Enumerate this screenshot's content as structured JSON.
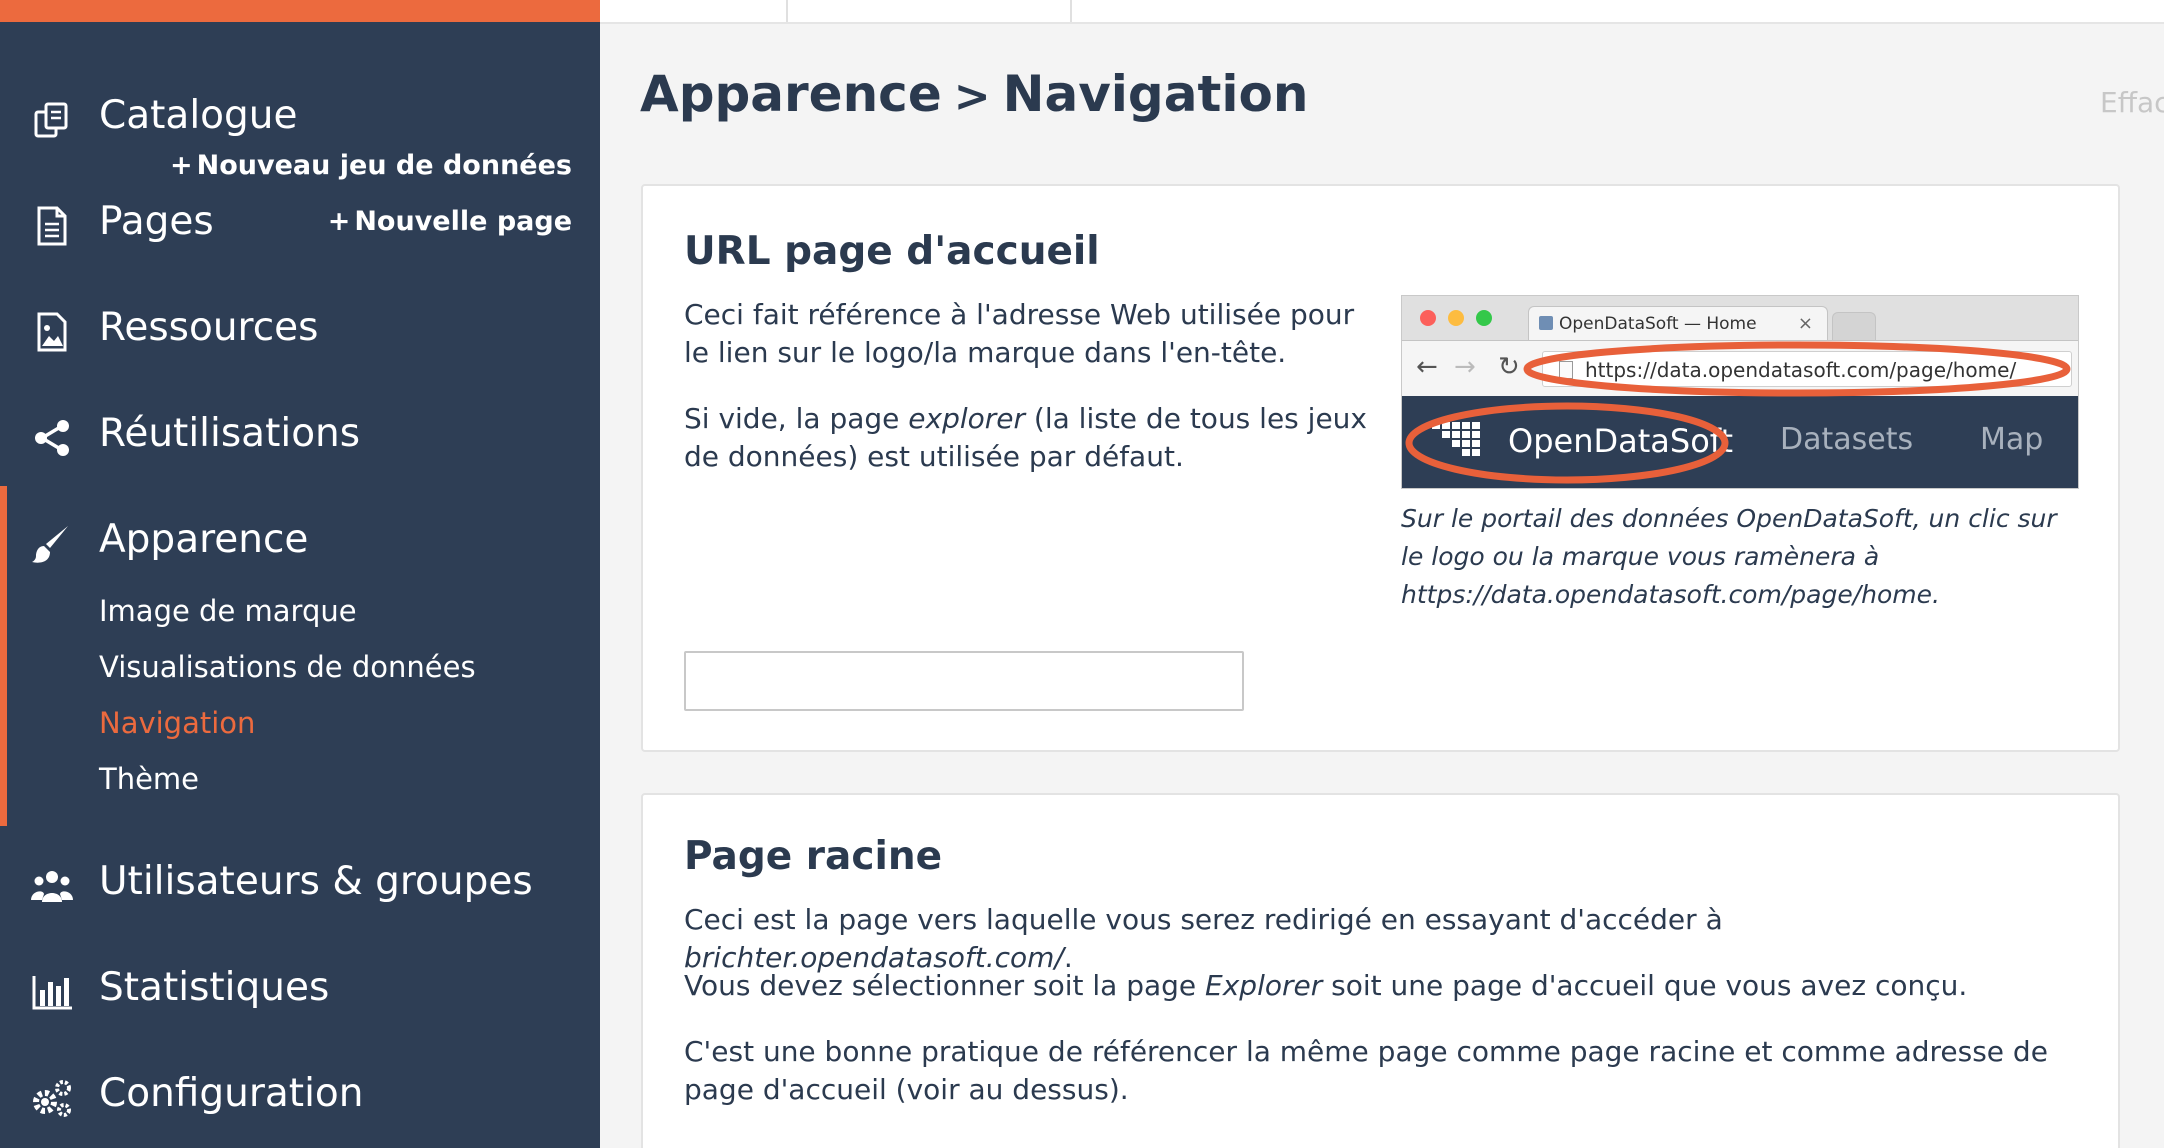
{
  "sidebar": {
    "items": [
      {
        "label": "Catalogue",
        "icon": "catalogue-icon",
        "action": "Nouveau jeu de données"
      },
      {
        "label": "Pages",
        "icon": "page-icon",
        "action": "Nouvelle page"
      },
      {
        "label": "Ressources",
        "icon": "image-icon"
      },
      {
        "label": "Réutilisations",
        "icon": "share-icon"
      },
      {
        "label": "Apparence",
        "icon": "brush-icon"
      },
      {
        "label": "Utilisateurs & groupes",
        "icon": "users-icon"
      },
      {
        "label": "Statistiques",
        "icon": "bar-chart-icon"
      },
      {
        "label": "Configuration",
        "icon": "gears-icon"
      }
    ],
    "subitems": [
      "Image de marque",
      "Visualisations de données",
      "Navigation",
      "Thème"
    ],
    "active_subitem": "Navigation"
  },
  "header": {
    "breadcrumb_parent": "Apparence",
    "breadcrumb_separator": ">",
    "breadcrumb_current": "Navigation",
    "faded_action": "Effac"
  },
  "card_url": {
    "title": "URL page d'accueil",
    "para1": "Ceci fait référence à l'adresse Web utilisée pour le lien sur le logo/la marque dans l'en-tête.",
    "para2_before": "Si vide, la page ",
    "para2_em": "explorer",
    "para2_after": " (la liste de tous les jeux de données) est utilisée par défaut.",
    "input_value": "",
    "caption": "Sur le portail des données OpenDataSoft, un clic sur le logo ou la marque vous ramènera à https://data.opendatasoft.com/page/home.",
    "illustration": {
      "tab_title": "OpenDataSoft — Home",
      "tab_close": "×",
      "url": "https://data.opendatasoft.com/page/home/",
      "brand": "OpenDataSoft",
      "nav_datasets": "Datasets",
      "nav_map": "Map",
      "highlight_color": "#e8603a"
    }
  },
  "card_root": {
    "title": "Page racine",
    "para1_before": "Ceci est la page vers laquelle vous serez redirigé en essayant d'accéder à ",
    "para1_em": "brichter.opendatasoft.com/",
    "para1_after": ".",
    "para2_before": "Vous devez sélectionner soit la page ",
    "para2_em": "Explorer",
    "para2_after": " soit une page d'accueil que vous avez conçu.",
    "para3": "C'est une bonne pratique de référencer la même page comme page racine et comme adresse de page d'accueil (voir au dessus)."
  },
  "colors": {
    "sidebar_bg": "#2e3e55",
    "accent": "#ec6a3e",
    "text": "#2b3a4f"
  }
}
